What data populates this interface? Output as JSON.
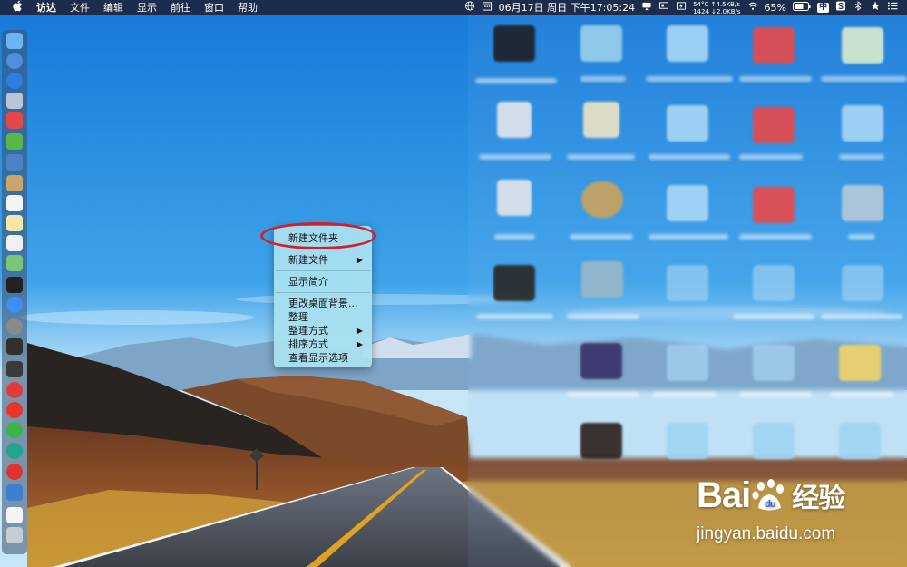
{
  "menubar": {
    "app_name": "访达",
    "menus": [
      "文件",
      "编辑",
      "显示",
      "前往",
      "窗口",
      "帮助"
    ],
    "datetime": "06月17日 周日 下午17:05:24",
    "network": {
      "temp": "54°C",
      "up": "↑4.5KB/s",
      "rpm": "1424",
      "down": "↓2.0KB/s"
    },
    "battery": "65%",
    "input_method": "中",
    "icons": [
      "apple-icon",
      "globe-icon",
      "calendar-icon",
      "airplay-icon",
      "display-icon",
      "battery-tool-icon",
      "wifi-icon",
      "battery-icon",
      "sogou-icon",
      "bluetooth-icon",
      "star-icon",
      "control-list-icon"
    ]
  },
  "dock": {
    "apps": [
      "finder",
      "siri",
      "safari",
      "launchpad",
      "jetbrains",
      "android-studio",
      "preview",
      "notes",
      "calendar",
      "textedit",
      "reminders",
      "maps",
      "terminal",
      "app-store",
      "system-preferences",
      "activity-monitor",
      "console",
      "vivaldi",
      "yandex",
      "wechat",
      "app-green",
      "netease-music",
      "sublime",
      "document",
      "trash"
    ],
    "colors": [
      "#6ab6f5",
      "#4e8fd8",
      "#2d7ee0",
      "#b8c5d6",
      "#e44848",
      "#59b64a",
      "#4a84c4",
      "#c9a56e",
      "#f4f4f4",
      "#f6e9a8",
      "#f0f0f0",
      "#7cc47a",
      "#222222",
      "#3e8ef7",
      "#8a8a8a",
      "#303030",
      "#3a3a3a",
      "#e33b3b",
      "#e8342a",
      "#3cb34a",
      "#21a58c",
      "#e0322f",
      "#3f7fd1",
      "#f4f4f4",
      "#c7ccd2"
    ]
  },
  "context_menu": {
    "items": [
      {
        "label": "新建文件夹",
        "has_submenu": false
      },
      {
        "label": "新建文件",
        "has_submenu": true
      },
      {
        "label": "显示简介",
        "has_submenu": false
      },
      {
        "label": "更改桌面背景...",
        "has_submenu": false
      },
      {
        "label": "整理",
        "has_submenu": false
      },
      {
        "label": "整理方式",
        "has_submenu": true
      },
      {
        "label": "排序方式",
        "has_submenu": true
      },
      {
        "label": "查看显示选项",
        "has_submenu": false
      }
    ],
    "arrow": "▶",
    "highlight_color": "#d0202c"
  },
  "watermark": {
    "brand": "Bai",
    "brand_tail": "du",
    "jingyan": "经验",
    "url": "jingyan.baidu.com"
  }
}
